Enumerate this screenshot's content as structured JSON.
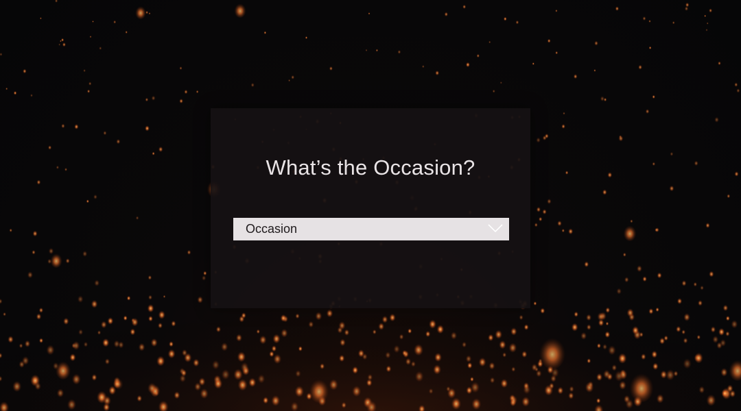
{
  "background": {
    "description_icon": "floating-sky-lanterns",
    "base_color": "#08080a",
    "lantern_color": "#ff7a2e"
  },
  "dialog": {
    "title": "What’s the Occasion?",
    "occasion_select": {
      "selected_value": "Occasion",
      "icon": "chevron-down-icon"
    }
  },
  "colors": {
    "panel": "#161113",
    "title_text": "#e9e4e6",
    "select_bg": "#e6e2e4",
    "select_text": "#1e1a1c",
    "chevron": "#ffffff"
  }
}
